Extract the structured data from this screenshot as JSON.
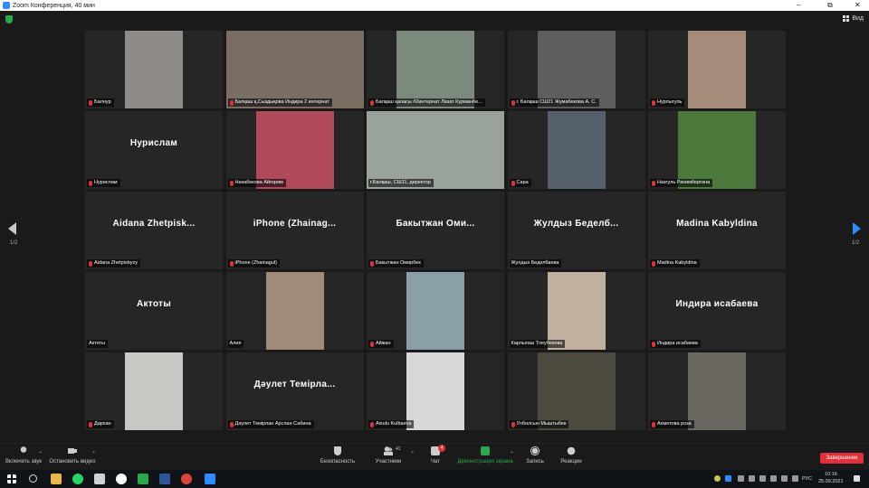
{
  "window": {
    "title": "Zoom Конференция, 40 мин"
  },
  "header": {
    "view_label": "Вид",
    "page_left": "1/2",
    "page_right": "1/2"
  },
  "tiles": [
    {
      "label": "Балнур",
      "muted": true,
      "video": true,
      "name_big": "",
      "bg": "#8e8a86"
    },
    {
      "label": "Балқаш қ,Сыздықова Индира 2 интернат",
      "muted": true,
      "video": true,
      "name_big": "",
      "bg": "#7a6d62"
    },
    {
      "label": "Балқаш қаласы #2интернат Лазат Курманбе...",
      "muted": true,
      "video": true,
      "name_big": "",
      "bg": "#7c8a7e"
    },
    {
      "label": "г. Балқаш СШ21 Жумабекова А. С.",
      "muted": true,
      "video": true,
      "name_big": "",
      "bg": "#5e5e5e"
    },
    {
      "label": "Нурлыгуль",
      "muted": true,
      "video": true,
      "name_big": "",
      "bg": "#a58c7a"
    },
    {
      "label": "Нурислам",
      "muted": true,
      "video": false,
      "name_big": "Нурислам",
      "bg": ""
    },
    {
      "label": "Низабекова Айгерим",
      "muted": true,
      "video": true,
      "name_big": "",
      "bg": "#b04a5a"
    },
    {
      "label": "г.Балқаш, СШ11, директор",
      "muted": false,
      "video": true,
      "name_big": "",
      "bg": "#9aa39a",
      "active": true
    },
    {
      "label": "Сара",
      "muted": true,
      "video": true,
      "name_big": "",
      "bg": "#55606c"
    },
    {
      "label": "Назгуль Рахимбергина",
      "muted": true,
      "video": true,
      "name_big": "",
      "bg": "#4d7a3c"
    },
    {
      "label": "Aidana Zhetpisbyzy",
      "muted": true,
      "video": false,
      "name_big": "Aidana Zhetpisk...",
      "bg": ""
    },
    {
      "label": "iPhone (Zhainagul)",
      "muted": true,
      "video": false,
      "name_big": "iPhone (Zhainag...",
      "bg": ""
    },
    {
      "label": "Бакытжан Омирбек",
      "muted": true,
      "video": false,
      "name_big": "Бакытжан Оми...",
      "bg": ""
    },
    {
      "label": "Жулдыз Беделбаева",
      "muted": false,
      "video": false,
      "name_big": "Жулдыз Беделб...",
      "bg": ""
    },
    {
      "label": "Madina Kabyldina",
      "muted": true,
      "video": false,
      "name_big": "Madina Kabyldina",
      "bg": ""
    },
    {
      "label": "Актоты",
      "muted": false,
      "video": false,
      "name_big": "Актоты",
      "bg": ""
    },
    {
      "label": "Алия",
      "muted": false,
      "video": true,
      "name_big": "",
      "bg": "#a08a78"
    },
    {
      "label": "Айжан",
      "muted": true,
      "video": true,
      "name_big": "",
      "bg": "#8aa0a8"
    },
    {
      "label": "Карлыгаш Тлеубекова",
      "muted": false,
      "video": true,
      "name_big": "",
      "bg": "#c0b0a0"
    },
    {
      "label": "Индира исабаева",
      "muted": true,
      "video": false,
      "name_big": "Индира исабаева",
      "bg": ""
    },
    {
      "label": "Дархан",
      "muted": true,
      "video": true,
      "name_big": "",
      "bg": "#c8c8c4"
    },
    {
      "label": "Дәулет Темірлан Арслан Сабина",
      "muted": true,
      "video": false,
      "name_big": "Дәулет Темірла...",
      "bg": ""
    },
    {
      "label": "Aisulu Kulbaeva",
      "muted": true,
      "video": true,
      "name_big": "",
      "bg": "#d8d8d8"
    },
    {
      "label": "Улболсын Мыштыбек",
      "muted": true,
      "video": true,
      "name_big": "",
      "bg": "#4c4a3e"
    },
    {
      "label": "Ахметова роза",
      "muted": true,
      "video": true,
      "name_big": "",
      "bg": "#6a6860"
    }
  ],
  "toolbar": {
    "mute_label": "Включить звук",
    "video_label": "Остановить видео",
    "security_label": "Безопасность",
    "participants_label": "Участники",
    "participants_count": "41",
    "chat_label": "Чат",
    "chat_badge": "4",
    "share_label": "Демонстрация экрана",
    "record_label": "Запись",
    "reactions_label": "Реакции",
    "end_label": "Завершение"
  },
  "taskbar": {
    "lang": "РУС",
    "time": "10:16",
    "date": "25.09.2021"
  }
}
